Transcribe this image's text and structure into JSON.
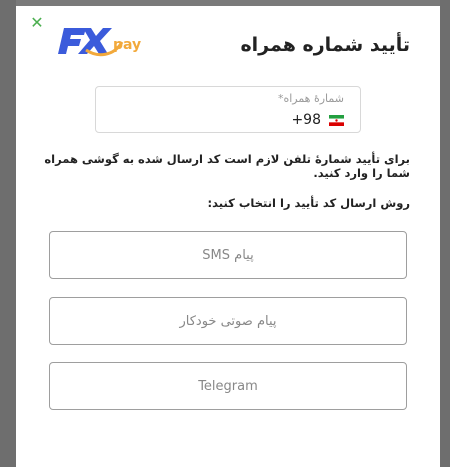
{
  "modal": {
    "close_icon": "close-icon",
    "logo_text_fx": "FX",
    "logo_text_pay": "pay",
    "title": "تأیید شماره همراه"
  },
  "phone": {
    "label": "شمارهٔ همراه*",
    "code": "+98",
    "flag_icon": "iran-flag-icon"
  },
  "instruction": "برای تأیید شمارهٔ تلفن لازم است کد ارسال شده به گوشی همراه شما را وارد کنید.",
  "method_label": "روش ارسال کد تأیید را انتخاب کنید:",
  "methods": [
    {
      "label": "پیام SMS"
    },
    {
      "label": "پیام صوتی خودکار"
    },
    {
      "label": "Telegram"
    }
  ],
  "colors": {
    "accent_green": "#4caf50",
    "logo_blue": "#3b5bdb",
    "logo_orange": "#f2a93b",
    "border": "#9e9e9e"
  }
}
